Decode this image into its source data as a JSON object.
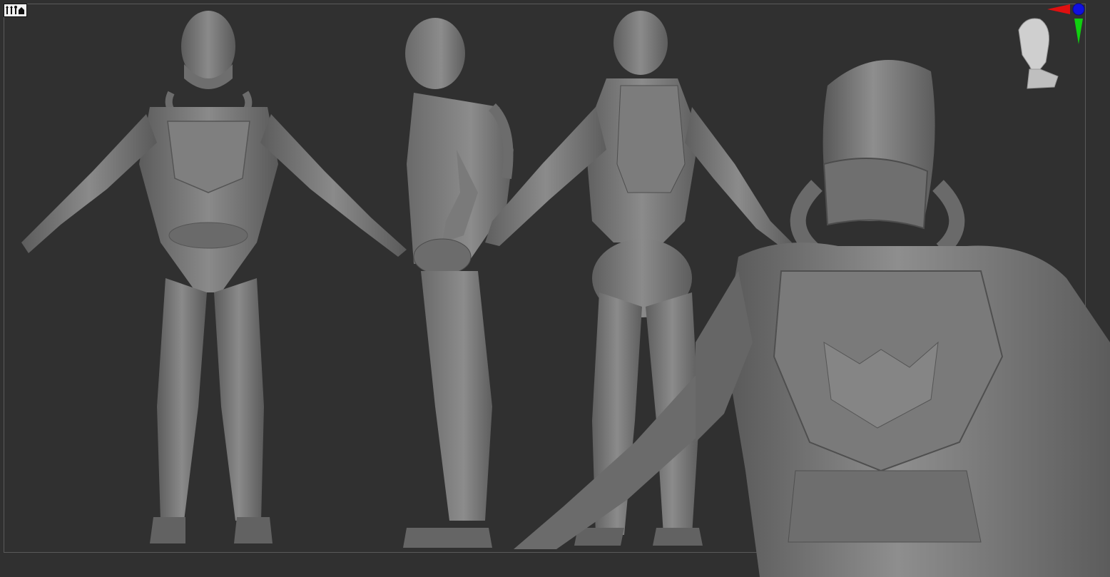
{
  "app": {
    "type": "3d-sculpt-viewport",
    "background_color": "#303030",
    "frame_color": "#5a5a5a"
  },
  "toolbar": {
    "mode_icon": "floor-grid-icon"
  },
  "gizmo": {
    "icon": "navigation-head-gizmo-icon",
    "axis_colors": {
      "x": "#e01010",
      "y": "#10d010",
      "z": "#1010e0"
    }
  },
  "viewport": {
    "views": [
      "front",
      "side",
      "back-three-quarter",
      "closeup-bust"
    ],
    "model_color": "#7a7a7a"
  }
}
